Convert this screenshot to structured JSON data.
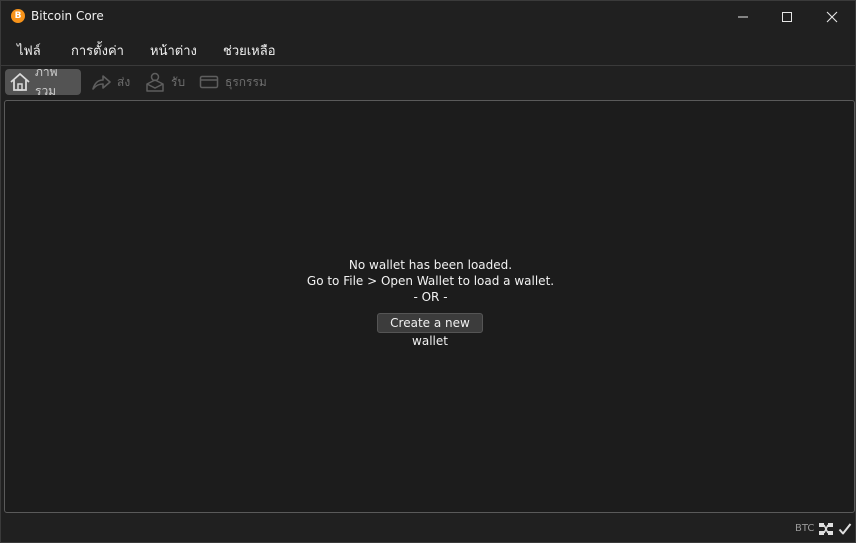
{
  "window": {
    "title": "Bitcoin Core",
    "app_icon_glyph": "B",
    "app_icon_color": "#f7931a",
    "controls": [
      "minimize-icon",
      "maximize-icon",
      "close-icon"
    ]
  },
  "menu": {
    "items": [
      {
        "label": "ไฟล์"
      },
      {
        "label": "การตั้งค่า"
      },
      {
        "label": "หน้าต่าง"
      },
      {
        "label": "ช่วยเหลือ"
      }
    ]
  },
  "toolbar": {
    "items": [
      {
        "label": "ภาพรวม",
        "icon": "home-icon",
        "active": true
      },
      {
        "label": "ส่ง",
        "icon": "send-arrow-icon",
        "active": false
      },
      {
        "label": "รับ",
        "icon": "receive-icon",
        "active": false
      },
      {
        "label": "ธุรกรรม",
        "icon": "transactions-icon",
        "active": false
      }
    ]
  },
  "main": {
    "line1": "No wallet has been loaded.",
    "line2": "Go to File > Open Wallet to load a wallet.",
    "line3": "- OR -",
    "create_button": "Create a new wallet"
  },
  "statusbar": {
    "unit": "BTC",
    "network_icon": "network-icon",
    "sync_icon": "checkmark-icon"
  }
}
